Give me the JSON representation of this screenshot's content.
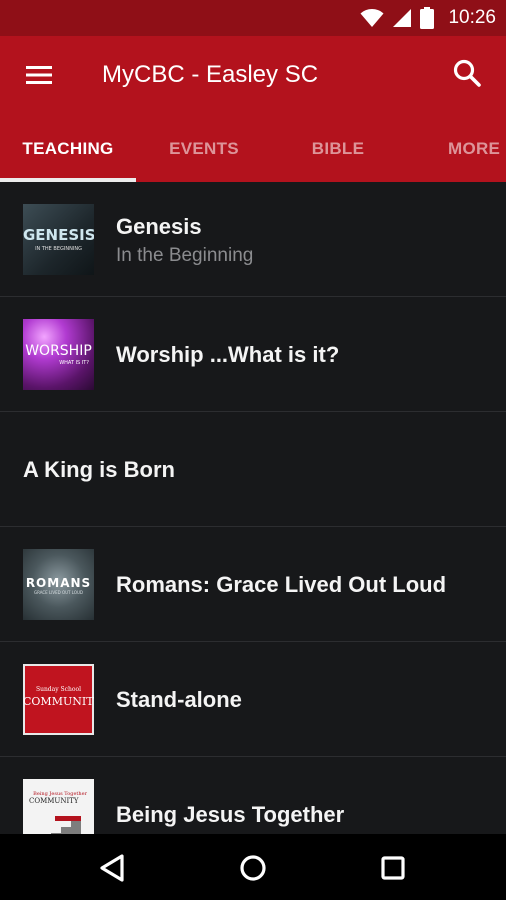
{
  "status_bar": {
    "time": "10:26",
    "icons": [
      "wifi-icon",
      "signal-icon",
      "battery-icon"
    ]
  },
  "app_bar": {
    "title": "MyCBC - Easley SC",
    "menu_icon": "hamburger-menu-icon",
    "search_icon": "search-icon"
  },
  "tabs": [
    {
      "label": "TEACHING",
      "active": true
    },
    {
      "label": "EVENTS",
      "active": false
    },
    {
      "label": "BIBLE",
      "active": false
    },
    {
      "label": "MORE",
      "active": false
    }
  ],
  "list": {
    "items": [
      {
        "title": "Genesis",
        "subtitle": "In the Beginning",
        "thumb_text": "GENESIS",
        "thumb_sub": "IN THE BEGINNING"
      },
      {
        "title": "Worship ...What is it?",
        "thumb_text": "WORSHIP",
        "thumb_sub": "WHAT IS IT?"
      },
      {
        "title": "A King is Born"
      },
      {
        "title": "Romans: Grace Lived Out Loud",
        "thumb_text": "ROMANS",
        "thumb_sub": "GRACE LIVED OUT LOUD"
      },
      {
        "title": "Stand-alone",
        "thumb_text": "COMMUNITY",
        "thumb_sub": "Sunday School"
      },
      {
        "title": "Being Jesus Together",
        "thumb_text": "COMMUNITY",
        "thumb_sub": "Being Jesus Together"
      }
    ]
  },
  "nav_bar": {
    "icons": [
      "back-icon",
      "home-icon",
      "recents-icon"
    ]
  },
  "colors": {
    "primary": "#b3121d",
    "primary_dark": "#8f0f17",
    "background": "#17181a",
    "text": "#f4f4f4",
    "subtext": "#8b8c8f"
  }
}
